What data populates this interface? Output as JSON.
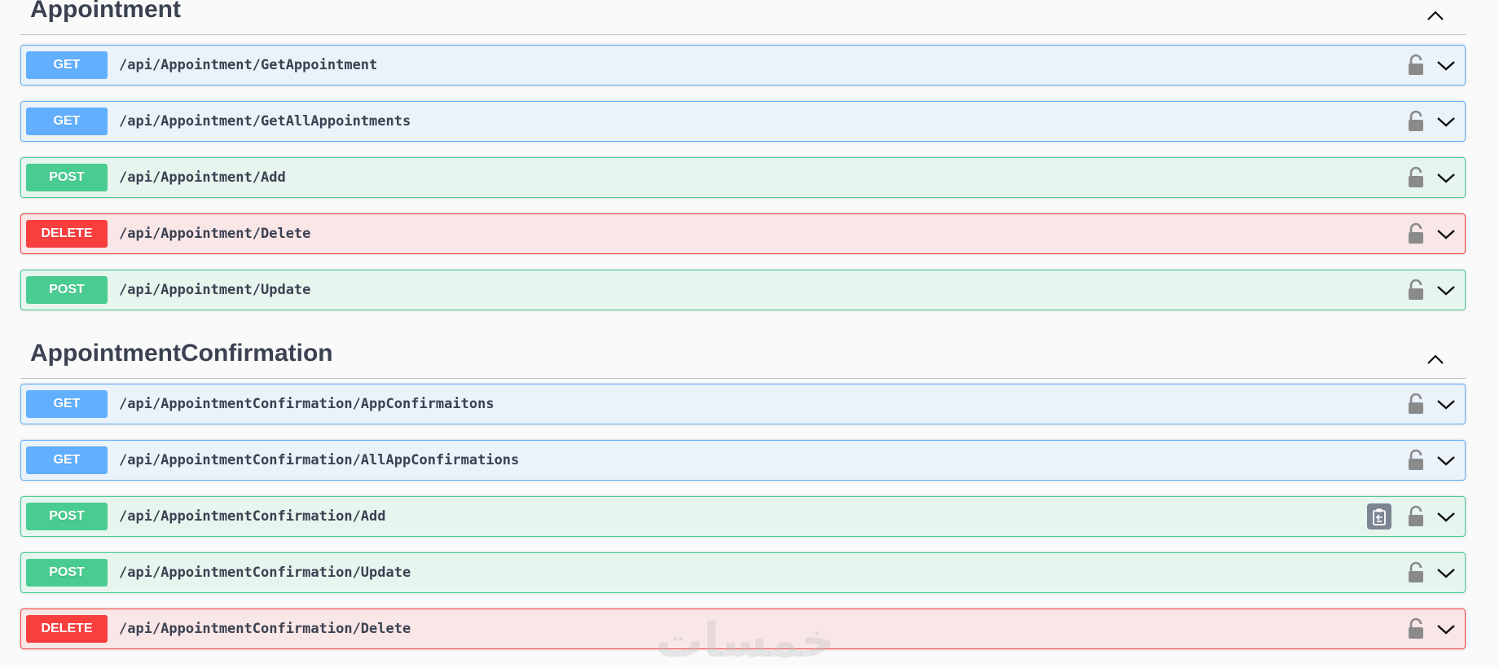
{
  "sections": [
    {
      "title": "Appointment",
      "operations": [
        {
          "method": "GET",
          "path": "/api/Appointment/GetAppointment"
        },
        {
          "method": "GET",
          "path": "/api/Appointment/GetAllAppointments"
        },
        {
          "method": "POST",
          "path": "/api/Appointment/Add"
        },
        {
          "method": "DELETE",
          "path": "/api/Appointment/Delete"
        },
        {
          "method": "POST",
          "path": "/api/Appointment/Update"
        }
      ]
    },
    {
      "title": "AppointmentConfirmation",
      "operations": [
        {
          "method": "GET",
          "path": "/api/AppointmentConfirmation/AppConfirmaitons"
        },
        {
          "method": "GET",
          "path": "/api/AppointmentConfirmation/AllAppConfirmations"
        },
        {
          "method": "POST",
          "path": "/api/AppointmentConfirmation/Add",
          "copy_icon": "copy-to-clipboard-icon"
        },
        {
          "method": "POST",
          "path": "/api/AppointmentConfirmation/Update"
        },
        {
          "method": "DELETE",
          "path": "/api/AppointmentConfirmation/Delete"
        }
      ]
    }
  ],
  "icons": {
    "collapse": "chevron-up-icon",
    "expand": "chevron-down-icon",
    "lock": "unlocked-padlock-icon"
  },
  "colors": {
    "get": "#61affe",
    "post": "#49cc90",
    "delete": "#f93e3e",
    "text": "#3b4151"
  },
  "watermark": "خمسات"
}
